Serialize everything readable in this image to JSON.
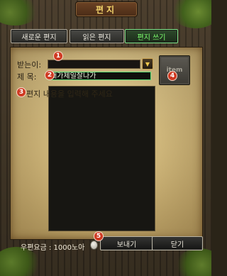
{
  "window": {
    "title": "편지"
  },
  "tabs": [
    {
      "label": "새로운 편지",
      "active": false
    },
    {
      "label": "읽은 편지",
      "active": false
    },
    {
      "label": "편지 쓰기",
      "active": true
    }
  ],
  "form": {
    "recipient_label": "받는이:",
    "recipient_value": "",
    "subject_label": "제 목:",
    "subject_value": "내가제일잘나가",
    "body_placeholder": "편지 내용을 입력해 주세요",
    "body_value": ""
  },
  "item_slot": {
    "label": "item"
  },
  "markers": [
    "1",
    "2",
    "3",
    "4",
    "5"
  ],
  "footer": {
    "postage_label": "우편요금 : 1000노아",
    "send_label": "보내기",
    "close_label": "닫기"
  },
  "icons": {
    "dropdown": "dropdown-arrow-icon",
    "coin": "coin-icon"
  },
  "colors": {
    "accent_active": "#7dff6e",
    "title": "#f2d36a",
    "marker": "#cf3a22"
  }
}
